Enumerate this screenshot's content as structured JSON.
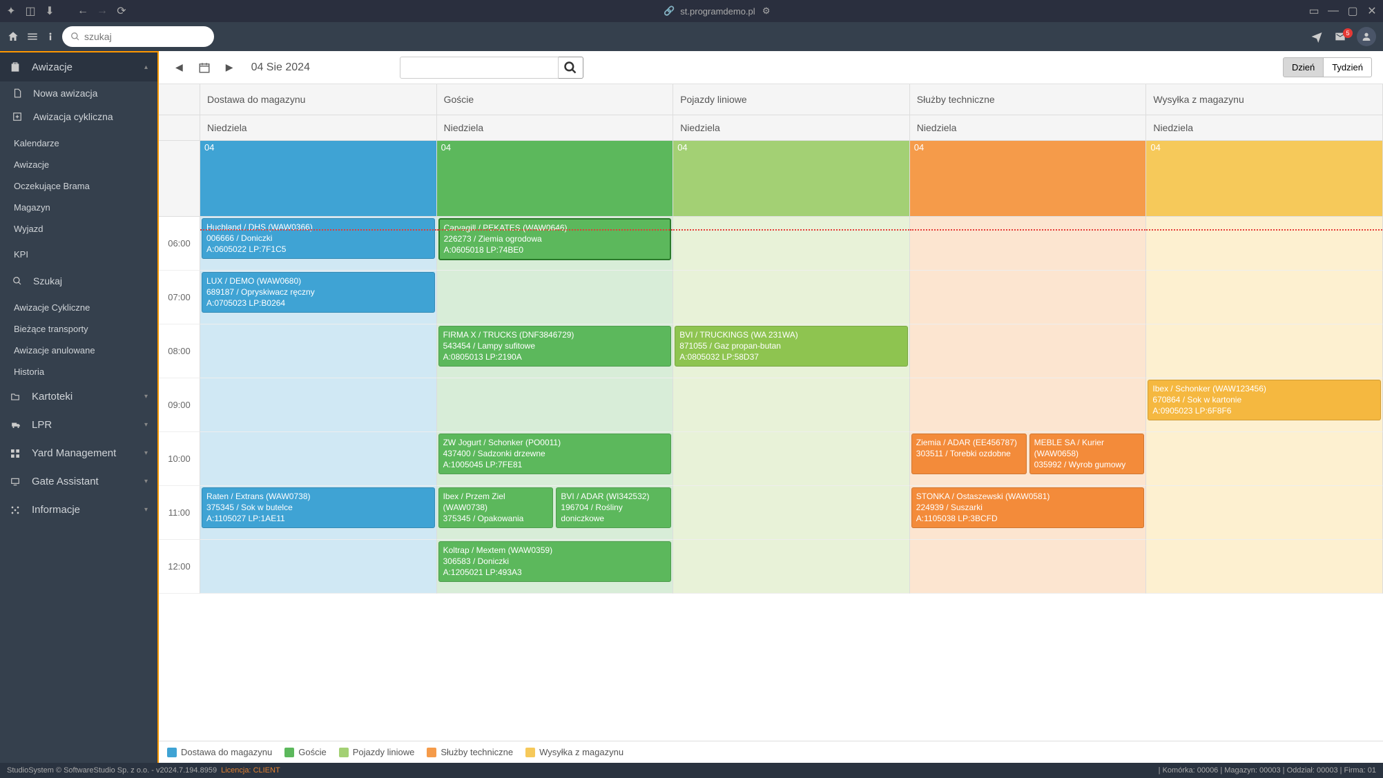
{
  "titlebar": {
    "url": "st.programdemo.pl"
  },
  "toolbar": {
    "search_placeholder": "szukaj",
    "mail_count": "5"
  },
  "sidebar": {
    "main": "Awizacje",
    "items": [
      {
        "label": "Nowa awizacja",
        "icon": "doc"
      },
      {
        "label": "Awizacja cykliczna",
        "icon": "plus"
      }
    ],
    "subs1": [
      "Kalendarze",
      "Awizacje",
      "Oczekujące Brama",
      "Magazyn",
      "Wyjazd"
    ],
    "kpi": "KPI",
    "search": "Szukaj",
    "subs2": [
      "Awizacje Cykliczne",
      "Bieżące transporty",
      "Awizacje anulowane",
      "Historia"
    ],
    "sections": [
      "Kartoteki",
      "LPR",
      "Yard Management",
      "Gate Assistant",
      "Informacje"
    ]
  },
  "calendar": {
    "date": "04 Sie 2024",
    "view_day": "Dzień",
    "view_week": "Tydzień",
    "columns": [
      "Dostawa do magazynu",
      "Goście",
      "Pojazdy liniowe",
      "Służby techniczne",
      "Wysyłka z magazynu"
    ],
    "weekday": "Niedziela",
    "daynum": "04",
    "times": [
      "06:00",
      "07:00",
      "08:00",
      "09:00",
      "10:00",
      "11:00",
      "12:00"
    ]
  },
  "events": {
    "r0c0": {
      "l1": "Huchland / DHS (WAW0366)",
      "l2": "006666 / Doniczki",
      "l3": "A:0605022 LP:7F1C5"
    },
    "r0c1": {
      "l1": "Carvagill / PEKATES (WAW0646)",
      "l2": "226273 / Ziemia ogrodowa",
      "l3": "A:0605018 LP:74BE0"
    },
    "r1c0": {
      "l1": "LUX / DEMO (WAW0680)",
      "l2": "689187 / Opryskiwacz ręczny",
      "l3": "A:0705023 LP:B0264"
    },
    "r2c1": {
      "l1": "FIRMA X / TRUCKS (DNF3846729)",
      "l2": "543454 / Lampy sufitowe",
      "l3": "A:0805013 LP:2190A"
    },
    "r2c2": {
      "l1": "BVI / TRUCKINGS (WA 231WA)",
      "l2": "871055 / Gaz propan-butan",
      "l3": "A:0805032 LP:58D37"
    },
    "r3c4": {
      "l1": "Ibex / Schonker (WAW123456)",
      "l2": "670864 / Sok w kartonie",
      "l3": "A:0905023 LP:6F8F6"
    },
    "r4c1": {
      "l1": "ZW Jogurt / Schonker (PO0011)",
      "l2": "437400 / Sadzonki drzewne",
      "l3": "A:1005045 LP:7FE81"
    },
    "r4c3a": {
      "l1": "Ziemia / ADAR (EE456787)",
      "l2": "303511 / Torebki ozdobne"
    },
    "r4c3b": {
      "l1": "MEBLE SA / Kurier (WAW0658)",
      "l2": "035992 / Wyrob gumowy"
    },
    "r5c0": {
      "l1": "Raten / Extrans (WAW0738)",
      "l2": "375345 / Sok w butelce",
      "l3": "A:1105027 LP:1AE11"
    },
    "r5c1a": {
      "l1": "Ibex / Przem Ziel (WAW0738)",
      "l2": "375345 / Opakowania"
    },
    "r5c1b": {
      "l1": "BVI / ADAR (WI342532)",
      "l2": "196704 / Rośliny doniczkowe"
    },
    "r5c3": {
      "l1": "STONKA / Ostaszewski (WAW0581)",
      "l2": "224939 / Suszarki",
      "l3": "A:1105038 LP:3BCFD"
    },
    "r6c1": {
      "l1": "Koltrap / Mextem (WAW0359)",
      "l2": "306583 / Doniczki",
      "l3": "A:1205021 LP:493A3"
    }
  },
  "legend": [
    "Dostawa do magazynu",
    "Goście",
    "Pojazdy liniowe",
    "Służby techniczne",
    "Wysyłka z magazynu"
  ],
  "status": {
    "left": "StudioSystem © SoftwareStudio Sp. z o.o. - v2024.7.194.8959",
    "license_label": "Licencja:",
    "license_val": "CLIENT",
    "right": "| Komórka: 00006 | Magazyn: 00003 | Oddział: 00003 | Firma: 01"
  }
}
